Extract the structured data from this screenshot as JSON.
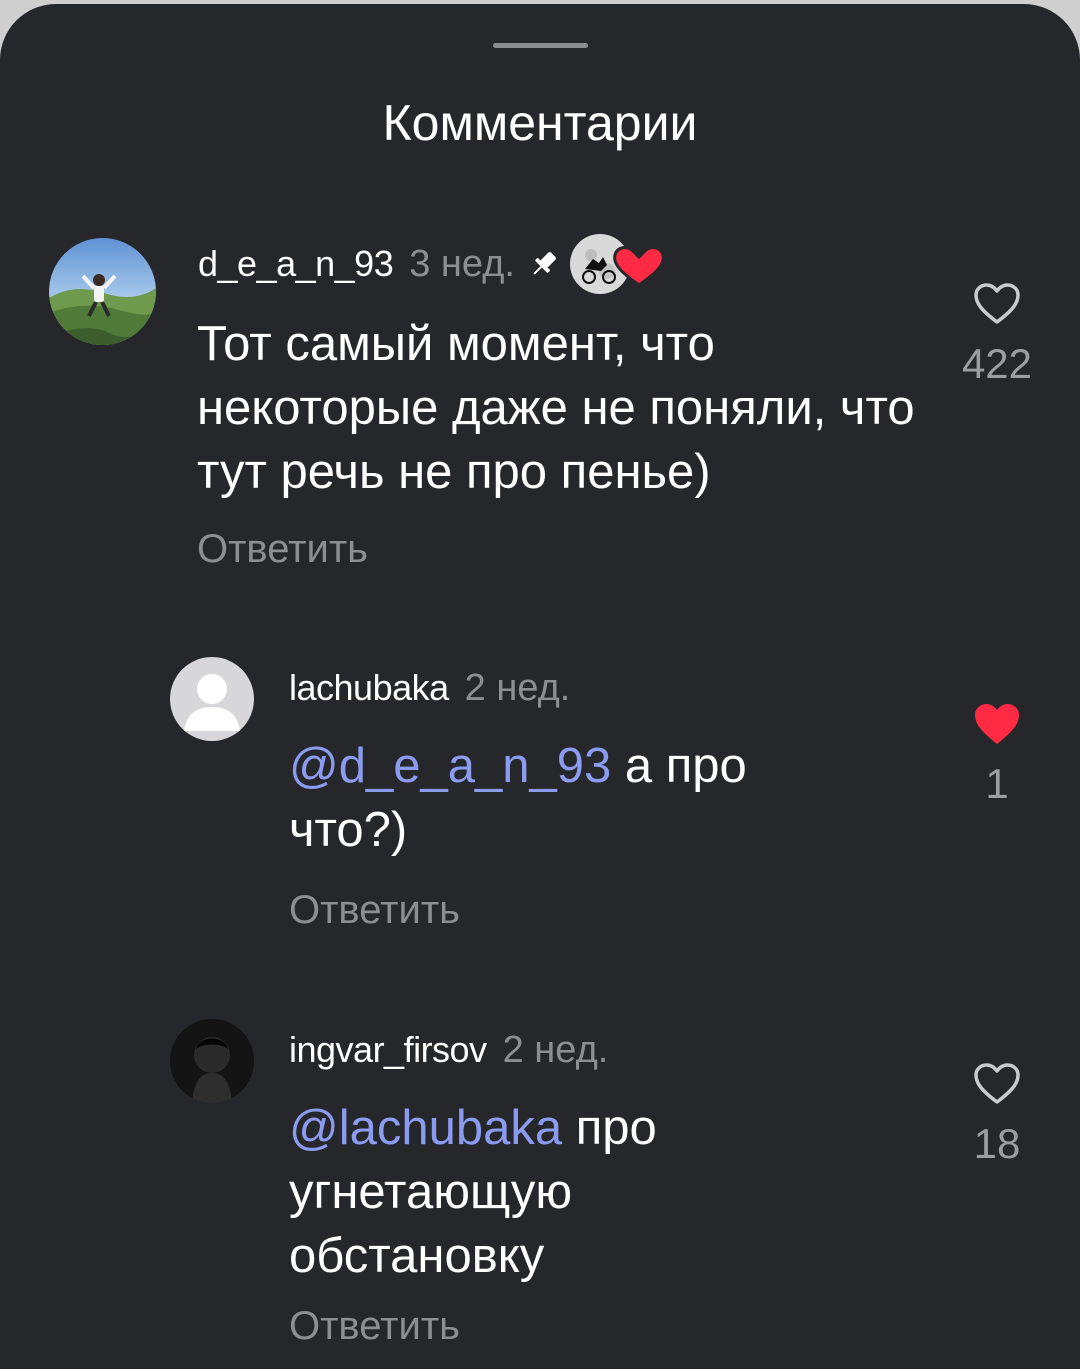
{
  "sheet": {
    "title": "Комментарии"
  },
  "comments": [
    {
      "username": "d_e_a_n_93",
      "time": "3 нед.",
      "text": "Тот самый момент, что некоторые даже не поняли, что тут речь не про пенье)",
      "reply_label": "Ответить",
      "likes": "422",
      "liked": false,
      "pinned": true
    },
    {
      "username": "lachubaka",
      "time": "2 нед.",
      "mention": "@d_e_a_n_93",
      "text": "а про что?)",
      "reply_label": "Ответить",
      "likes": "1",
      "liked": true
    },
    {
      "username": "ingvar_firsov",
      "time": "2 нед.",
      "mention": "@lachubaka",
      "text": "про угнетающую обстановку",
      "reply_label": "Ответить",
      "likes": "18",
      "liked": false
    }
  ],
  "icons": {
    "like_empty": "heart-outline-icon",
    "like_filled": "heart-filled-icon",
    "pin": "pin-icon"
  },
  "colors": {
    "background": "#26272b",
    "mention": "#8b9bf0",
    "like_active": "#ff2a44",
    "secondary_text": "#8d8e93"
  }
}
